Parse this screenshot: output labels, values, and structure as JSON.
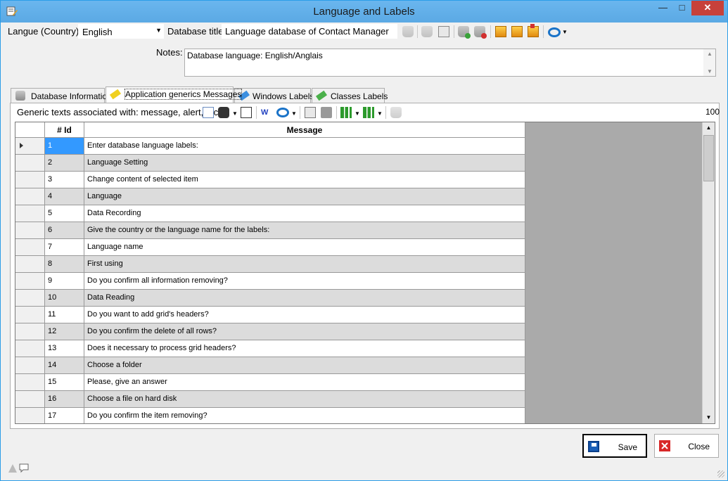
{
  "window": {
    "title": "Language and Labels"
  },
  "header": {
    "language_label": "Langue (Country):",
    "language_value": "English",
    "db_title_label": "Database title:",
    "db_title_value": "Language database of Contact Manager",
    "notes_label": "Notes:",
    "notes_value": "Database language: English/Anglais"
  },
  "tabs": [
    {
      "label": "Database Information",
      "active": false
    },
    {
      "label": "Application generics Messages",
      "active": true
    },
    {
      "label": "Windows Labels",
      "active": false
    },
    {
      "label": "Classes Labels",
      "active": false
    }
  ],
  "toolbar": {
    "caption": "Generic texts associated with: message, alert, etc.",
    "count": "100"
  },
  "grid": {
    "columns": [
      "# Id",
      "Message"
    ],
    "rows": [
      {
        "id": "1",
        "message": "Enter database language labels:"
      },
      {
        "id": "2",
        "message": "Language Setting"
      },
      {
        "id": "3",
        "message": "Change content of selected item"
      },
      {
        "id": "4",
        "message": "Language"
      },
      {
        "id": "5",
        "message": "Data Recording"
      },
      {
        "id": "6",
        "message": "Give the country or the language name for the labels:"
      },
      {
        "id": "7",
        "message": "Language name"
      },
      {
        "id": "8",
        "message": "First using"
      },
      {
        "id": "9",
        "message": "Do you confirm all information removing?"
      },
      {
        "id": "10",
        "message": "Data Reading"
      },
      {
        "id": "11",
        "message": "Do you want to add grid's headers?"
      },
      {
        "id": "12",
        "message": "Do you confirm the delete of all rows?"
      },
      {
        "id": "13",
        "message": "Does it necessary to process grid headers?"
      },
      {
        "id": "14",
        "message": "Choose a folder"
      },
      {
        "id": "15",
        "message": "Please, give an answer"
      },
      {
        "id": "16",
        "message": "Choose a file on hard disk"
      },
      {
        "id": "17",
        "message": "Do you confirm the item removing?"
      }
    ]
  },
  "buttons": {
    "save": "Save",
    "close": "Close"
  },
  "colors": {
    "titlebar": "#5ba9e4",
    "selection": "#3399ff",
    "close_button": "#c7413a"
  },
  "icons": [
    "app-icon",
    "database-icon",
    "add-database-icon",
    "remove-database-icon",
    "box-icon",
    "bing-icon",
    "save-icon",
    "close-icon",
    "warning-icon",
    "comment-icon"
  ]
}
